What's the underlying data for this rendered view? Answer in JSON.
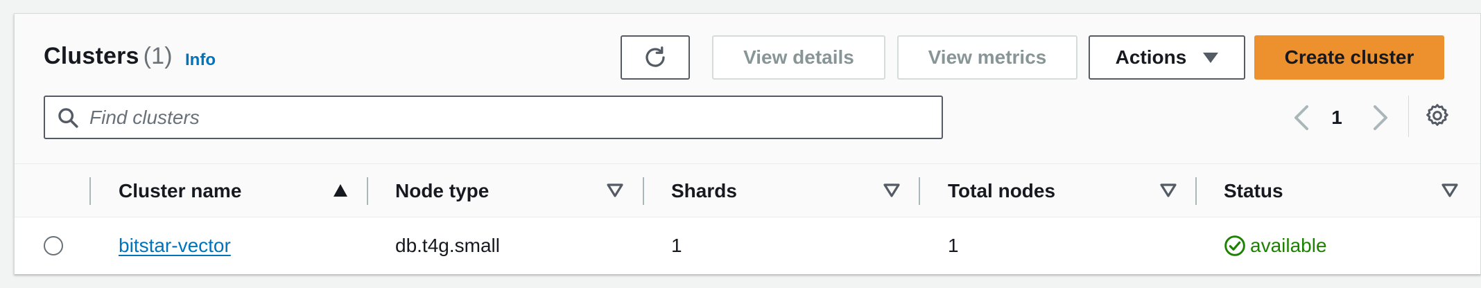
{
  "header": {
    "title": "Clusters",
    "count": "(1)",
    "info_label": "Info"
  },
  "toolbar": {
    "refresh_icon": "refresh-icon",
    "view_details_label": "View details",
    "view_metrics_label": "View metrics",
    "actions_label": "Actions",
    "create_label": "Create cluster"
  },
  "search": {
    "placeholder": "Find clusters",
    "value": ""
  },
  "pagination": {
    "current_page": "1"
  },
  "table": {
    "columns": [
      {
        "label": "Cluster name",
        "sort": "ascending"
      },
      {
        "label": "Node type",
        "sort": "none"
      },
      {
        "label": "Shards",
        "sort": "none"
      },
      {
        "label": "Total nodes",
        "sort": "none"
      },
      {
        "label": "Status",
        "sort": "none"
      }
    ],
    "rows": [
      {
        "cluster_name": "bitstar-vector",
        "node_type": "db.t4g.small",
        "shards": "1",
        "total_nodes": "1",
        "status": "available"
      }
    ]
  },
  "colors": {
    "primary_button": "#ec912d",
    "link": "#0073bb",
    "status_available": "#1d8102"
  }
}
